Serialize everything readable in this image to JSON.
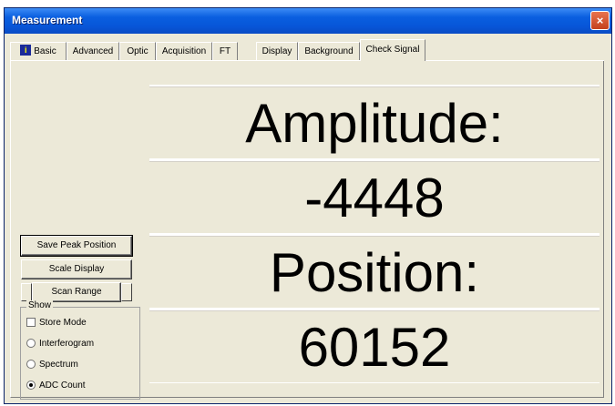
{
  "window": {
    "title": "Measurement",
    "close_label": "×"
  },
  "tabs": [
    {
      "label": "Basic",
      "icon": "info-icon"
    },
    {
      "label": "Advanced"
    },
    {
      "label": "Optic"
    },
    {
      "label": "Acquisition"
    },
    {
      "label": "FT"
    },
    {
      "label": "Display"
    },
    {
      "label": "Background"
    },
    {
      "label": "Check Signal",
      "active": true
    }
  ],
  "controls": {
    "save_peak_label": "Save Peak Position",
    "scale_display_label": "Scale Display",
    "scan_range_label": "Scan Range"
  },
  "show_group": {
    "label": "Show",
    "options": [
      {
        "label": "Store Mode",
        "type": "checkbox",
        "checked": false
      },
      {
        "label": "Interferogram",
        "type": "radio",
        "checked": false
      },
      {
        "label": "Spectrum",
        "type": "radio",
        "checked": false
      },
      {
        "label": "ADC Count",
        "type": "radio",
        "checked": true
      }
    ]
  },
  "readout": {
    "amplitude_label": "Amplitude:",
    "amplitude_value": "-4448",
    "position_label": "Position:",
    "position_value": "60152"
  },
  "colors": {
    "title_bar": "#0a5fe0",
    "face": "#ece9d8"
  }
}
